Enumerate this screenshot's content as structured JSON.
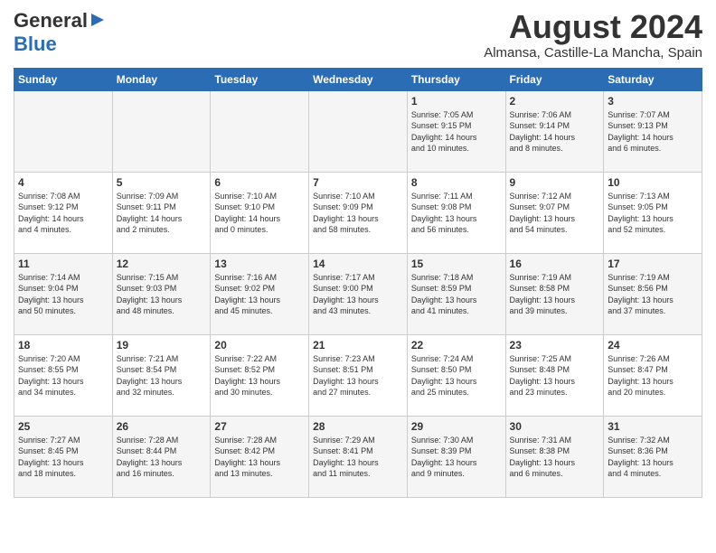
{
  "header": {
    "logo_general": "General",
    "logo_blue": "Blue",
    "month_year": "August 2024",
    "location": "Almansa, Castille-La Mancha, Spain"
  },
  "days_of_week": [
    "Sunday",
    "Monday",
    "Tuesday",
    "Wednesday",
    "Thursday",
    "Friday",
    "Saturday"
  ],
  "weeks": [
    [
      {
        "day": "",
        "info": ""
      },
      {
        "day": "",
        "info": ""
      },
      {
        "day": "",
        "info": ""
      },
      {
        "day": "",
        "info": ""
      },
      {
        "day": "1",
        "info": "Sunrise: 7:05 AM\nSunset: 9:15 PM\nDaylight: 14 hours\nand 10 minutes."
      },
      {
        "day": "2",
        "info": "Sunrise: 7:06 AM\nSunset: 9:14 PM\nDaylight: 14 hours\nand 8 minutes."
      },
      {
        "day": "3",
        "info": "Sunrise: 7:07 AM\nSunset: 9:13 PM\nDaylight: 14 hours\nand 6 minutes."
      }
    ],
    [
      {
        "day": "4",
        "info": "Sunrise: 7:08 AM\nSunset: 9:12 PM\nDaylight: 14 hours\nand 4 minutes."
      },
      {
        "day": "5",
        "info": "Sunrise: 7:09 AM\nSunset: 9:11 PM\nDaylight: 14 hours\nand 2 minutes."
      },
      {
        "day": "6",
        "info": "Sunrise: 7:10 AM\nSunset: 9:10 PM\nDaylight: 14 hours\nand 0 minutes."
      },
      {
        "day": "7",
        "info": "Sunrise: 7:10 AM\nSunset: 9:09 PM\nDaylight: 13 hours\nand 58 minutes."
      },
      {
        "day": "8",
        "info": "Sunrise: 7:11 AM\nSunset: 9:08 PM\nDaylight: 13 hours\nand 56 minutes."
      },
      {
        "day": "9",
        "info": "Sunrise: 7:12 AM\nSunset: 9:07 PM\nDaylight: 13 hours\nand 54 minutes."
      },
      {
        "day": "10",
        "info": "Sunrise: 7:13 AM\nSunset: 9:05 PM\nDaylight: 13 hours\nand 52 minutes."
      }
    ],
    [
      {
        "day": "11",
        "info": "Sunrise: 7:14 AM\nSunset: 9:04 PM\nDaylight: 13 hours\nand 50 minutes."
      },
      {
        "day": "12",
        "info": "Sunrise: 7:15 AM\nSunset: 9:03 PM\nDaylight: 13 hours\nand 48 minutes."
      },
      {
        "day": "13",
        "info": "Sunrise: 7:16 AM\nSunset: 9:02 PM\nDaylight: 13 hours\nand 45 minutes."
      },
      {
        "day": "14",
        "info": "Sunrise: 7:17 AM\nSunset: 9:00 PM\nDaylight: 13 hours\nand 43 minutes."
      },
      {
        "day": "15",
        "info": "Sunrise: 7:18 AM\nSunset: 8:59 PM\nDaylight: 13 hours\nand 41 minutes."
      },
      {
        "day": "16",
        "info": "Sunrise: 7:19 AM\nSunset: 8:58 PM\nDaylight: 13 hours\nand 39 minutes."
      },
      {
        "day": "17",
        "info": "Sunrise: 7:19 AM\nSunset: 8:56 PM\nDaylight: 13 hours\nand 37 minutes."
      }
    ],
    [
      {
        "day": "18",
        "info": "Sunrise: 7:20 AM\nSunset: 8:55 PM\nDaylight: 13 hours\nand 34 minutes."
      },
      {
        "day": "19",
        "info": "Sunrise: 7:21 AM\nSunset: 8:54 PM\nDaylight: 13 hours\nand 32 minutes."
      },
      {
        "day": "20",
        "info": "Sunrise: 7:22 AM\nSunset: 8:52 PM\nDaylight: 13 hours\nand 30 minutes."
      },
      {
        "day": "21",
        "info": "Sunrise: 7:23 AM\nSunset: 8:51 PM\nDaylight: 13 hours\nand 27 minutes."
      },
      {
        "day": "22",
        "info": "Sunrise: 7:24 AM\nSunset: 8:50 PM\nDaylight: 13 hours\nand 25 minutes."
      },
      {
        "day": "23",
        "info": "Sunrise: 7:25 AM\nSunset: 8:48 PM\nDaylight: 13 hours\nand 23 minutes."
      },
      {
        "day": "24",
        "info": "Sunrise: 7:26 AM\nSunset: 8:47 PM\nDaylight: 13 hours\nand 20 minutes."
      }
    ],
    [
      {
        "day": "25",
        "info": "Sunrise: 7:27 AM\nSunset: 8:45 PM\nDaylight: 13 hours\nand 18 minutes."
      },
      {
        "day": "26",
        "info": "Sunrise: 7:28 AM\nSunset: 8:44 PM\nDaylight: 13 hours\nand 16 minutes."
      },
      {
        "day": "27",
        "info": "Sunrise: 7:28 AM\nSunset: 8:42 PM\nDaylight: 13 hours\nand 13 minutes."
      },
      {
        "day": "28",
        "info": "Sunrise: 7:29 AM\nSunset: 8:41 PM\nDaylight: 13 hours\nand 11 minutes."
      },
      {
        "day": "29",
        "info": "Sunrise: 7:30 AM\nSunset: 8:39 PM\nDaylight: 13 hours\nand 9 minutes."
      },
      {
        "day": "30",
        "info": "Sunrise: 7:31 AM\nSunset: 8:38 PM\nDaylight: 13 hours\nand 6 minutes."
      },
      {
        "day": "31",
        "info": "Sunrise: 7:32 AM\nSunset: 8:36 PM\nDaylight: 13 hours\nand 4 minutes."
      }
    ]
  ]
}
